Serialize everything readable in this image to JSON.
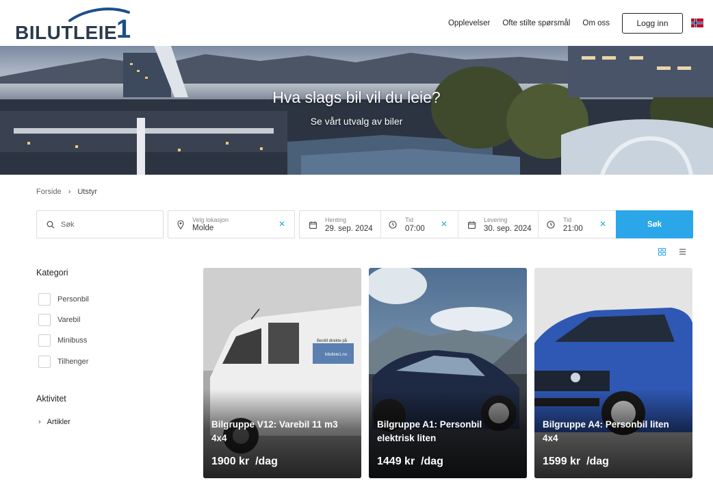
{
  "logo": {
    "text": "BILUTLEIE",
    "numeral": "1"
  },
  "nav": {
    "links": [
      "Opplevelser",
      "Ofte stilte spørsmål",
      "Om oss"
    ],
    "login_label": "Logg inn"
  },
  "hero": {
    "title": "Hva slags bil vil du leie?",
    "subtitle": "Se vårt utvalg av biler"
  },
  "breadcrumb": {
    "home": "Forside",
    "current": "Utstyr"
  },
  "search": {
    "placeholder": "Søk",
    "location_label": "Velg lokasjon",
    "location_value": "Molde",
    "pickup_label": "Henting",
    "pickup_date": "29. sep. 2024",
    "pickup_time_label": "Tid",
    "pickup_time": "07:00",
    "return_label": "Levering",
    "return_date": "30. sep. 2024",
    "return_time_label": "Tid",
    "return_time": "21:00",
    "button_label": "Søk"
  },
  "sidebar": {
    "category_heading": "Kategori",
    "categories": [
      "Personbil",
      "Varebil",
      "Minibuss",
      "Tilhenger"
    ],
    "activity_heading": "Aktivitet",
    "activities": [
      "Artikler"
    ]
  },
  "cards": [
    {
      "title": "Bilgruppe V12: Varebil 11 m3 4x4",
      "price": "1900 kr",
      "unit": "/dag",
      "van_text_1": "Bestill direkte på",
      "van_text_2": "bilutleie1.no"
    },
    {
      "title": "Bilgruppe A1: Personbil elektrisk liten",
      "price": "1449 kr",
      "unit": "/dag"
    },
    {
      "title": "Bilgruppe A4: Personbil liten 4x4",
      "price": "1599 kr",
      "unit": "/dag"
    }
  ],
  "colors": {
    "accent": "#2aa6e9",
    "logo_dark": "#2b3a4c",
    "logo_blue": "#1b4f8a"
  },
  "icons": {
    "search": "magnifier-icon",
    "location": "map-pin-icon",
    "calendar": "calendar-icon",
    "clock": "clock-icon",
    "clear": "x-icon",
    "grid_view": "grid-icon",
    "list_view": "list-icon",
    "flag": "norway-flag-icon",
    "chevron": "chevron-right-icon"
  }
}
